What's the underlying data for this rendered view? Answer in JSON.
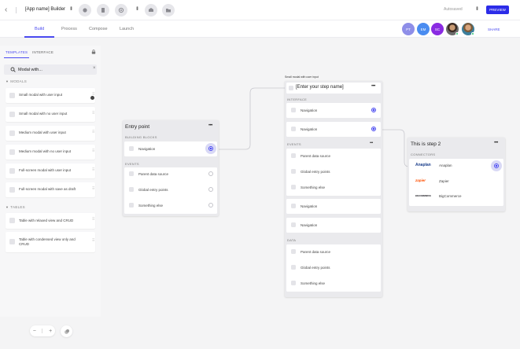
{
  "topbar": {
    "back_icon": "chevron-left-icon",
    "title": "[App name] Builder",
    "toolbar_icons": [
      "undo-icon",
      "file-icon",
      "shield-icon",
      "database-icon",
      "folder-icon"
    ],
    "autosaved": "Autosaved",
    "preview_label": "PREVIEW",
    "accent": "#2c2ce8"
  },
  "tabs": {
    "items": [
      {
        "label": "Build",
        "active": true
      },
      {
        "label": "Process",
        "active": false
      },
      {
        "label": "Compose",
        "active": false
      },
      {
        "label": "Launch",
        "active": false
      }
    ]
  },
  "collaborators": {
    "avatars": [
      {
        "initials": "PT",
        "color": "#8e8ee8"
      },
      {
        "initials": "EM",
        "color": "#4a8cf0"
      },
      {
        "initials": "SC",
        "color": "#8a2be2"
      },
      {
        "initials": "",
        "color": ""
      },
      {
        "initials": "",
        "color": ""
      }
    ],
    "share_label": "SHARE"
  },
  "leftpanel": {
    "tabs": [
      {
        "label": "TEMPLATES",
        "active": true
      },
      {
        "label": "INTERFACE",
        "active": false
      }
    ],
    "search_value": "Modal with...",
    "sections": [
      {
        "title": "MODALS",
        "items": [
          "Small modal with user input",
          "Small modal with no user input",
          "Medium modal with user input",
          "Medium modal with no user input",
          "Full-screen modal with user input",
          "Full-screen modal with save as draft"
        ]
      },
      {
        "title": "TABLES",
        "items": [
          "Table with relaxed view and CRUD",
          "Table with condensed view only and CRUD"
        ]
      }
    ]
  },
  "canvas": {
    "entry": {
      "title": "Entry point",
      "building_blocks_label": "BUILDING BLOCKS",
      "building_blocks": [
        "Navigation"
      ],
      "events_label": "EVENTS",
      "events": [
        "Parent data source",
        "Global entry points",
        "Something else"
      ]
    },
    "step": {
      "note": "Small modal with user input",
      "title": "[Enter your step name]",
      "interface_label": "INTERFACE",
      "interface": [
        "Navigation",
        "Navigation"
      ],
      "events_label": "EVENTS",
      "events": [
        "Parent data source",
        "Global entry points",
        "Something else"
      ],
      "extra": [
        "Navigation",
        "Navigation"
      ],
      "data_label": "DATA",
      "data": [
        "Parent data source",
        "Global entry points",
        "Something else"
      ]
    },
    "step2": {
      "title": "This is step 2",
      "connectors_label": "CONNECTORS",
      "connectors": [
        {
          "logo": "Anaplan",
          "label": "Anaplan",
          "color": "#1c3f8c"
        },
        {
          "logo": "zapier",
          "label": "Zapier",
          "color": "#ff4f00"
        },
        {
          "logo": "BIGCOMMERCE",
          "label": "BigCommerce",
          "color": "#121118"
        }
      ]
    }
  },
  "zoom": {
    "minus": "−",
    "plus": "+"
  }
}
